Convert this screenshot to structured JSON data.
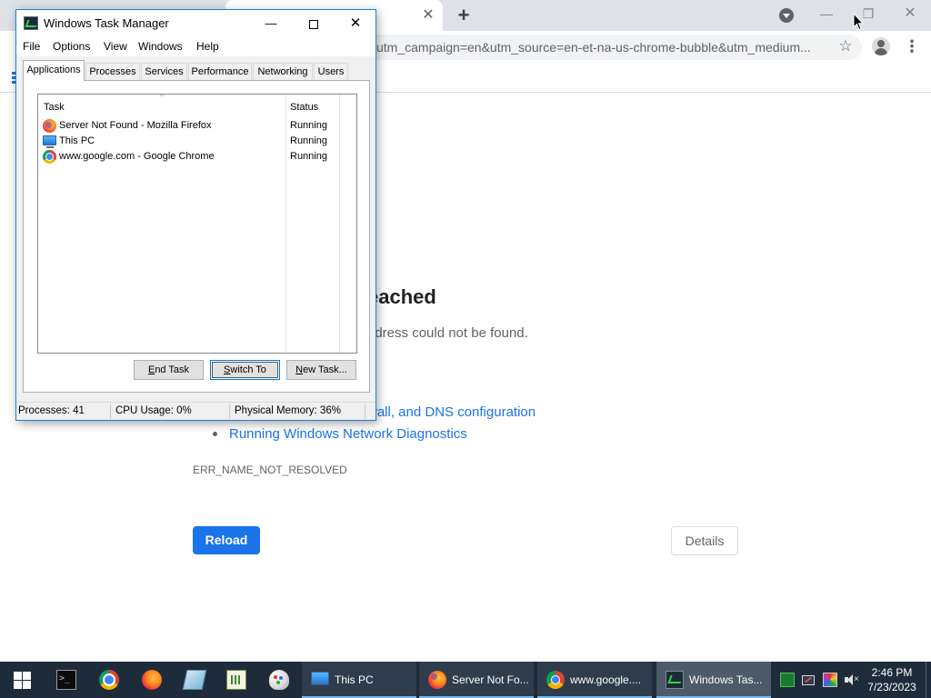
{
  "chrome": {
    "tab_close_icon": "close-icon",
    "new_tab_label": "+",
    "url": "utm_campaign=en&utm_source=en-et-na-us-chrome-bubble&utm_medium...",
    "window_controls": {
      "minimize": "—",
      "restore": "❐",
      "close": "✕"
    },
    "page": {
      "heading_fragment": "eached",
      "subtext_fragment": "ddress could not be found.",
      "link1_fragment": "wall, and DNS configuration",
      "link2": "Running Windows Network Diagnostics",
      "error_code": "ERR_NAME_NOT_RESOLVED",
      "reload_label": "Reload",
      "details_label": "Details"
    },
    "colors": {
      "accent": "#1a73e8",
      "tabstrip": "#dee1e6"
    }
  },
  "task_manager": {
    "title": "Windows Task Manager",
    "window_controls": {
      "minimize": "—",
      "close": "✕"
    },
    "menu": [
      "File",
      "Options",
      "View",
      "Windows",
      "Help"
    ],
    "tabs": [
      "Applications",
      "Processes",
      "Services",
      "Performance",
      "Networking",
      "Users"
    ],
    "selected_tab": "Applications",
    "columns": {
      "task": "Task",
      "status": "Status"
    },
    "sort_indicator": "^",
    "applications": [
      {
        "name": "Server Not Found - Mozilla Firefox",
        "status": "Running",
        "icon": "firefox-icon"
      },
      {
        "name": "This PC",
        "status": "Running",
        "icon": "this-pc-icon"
      },
      {
        "name": "www.google.com - Google Chrome",
        "status": "Running",
        "icon": "chrome-icon"
      }
    ],
    "buttons": {
      "end_task": {
        "mnemonic": "E",
        "rest": "nd Task"
      },
      "switch_to": {
        "mnemonic": "S",
        "rest": "witch To"
      },
      "new_task": {
        "mnemonic": "N",
        "rest": "ew Task..."
      }
    },
    "status": {
      "processes": "Processes: 41",
      "cpu": "CPU Usage: 0%",
      "memory": "Physical Memory: 36%"
    }
  },
  "taskbar": {
    "pinned": [
      "start-icon",
      "command-prompt-icon",
      "chrome-icon",
      "firefox-icon",
      "notepad-icon",
      "spreadsheet-icon",
      "paint-icon"
    ],
    "tasks": [
      {
        "label": "This PC",
        "icon": "this-pc-icon"
      },
      {
        "label": "Server Not Fo...",
        "icon": "firefox-icon"
      },
      {
        "label": "www.google....",
        "icon": "chrome-icon"
      },
      {
        "label": "Windows Tas...",
        "icon": "task-manager-icon"
      }
    ],
    "tray": {
      "mute_glyph": "×",
      "time": "2:46 PM",
      "date": "7/23/2023"
    }
  }
}
